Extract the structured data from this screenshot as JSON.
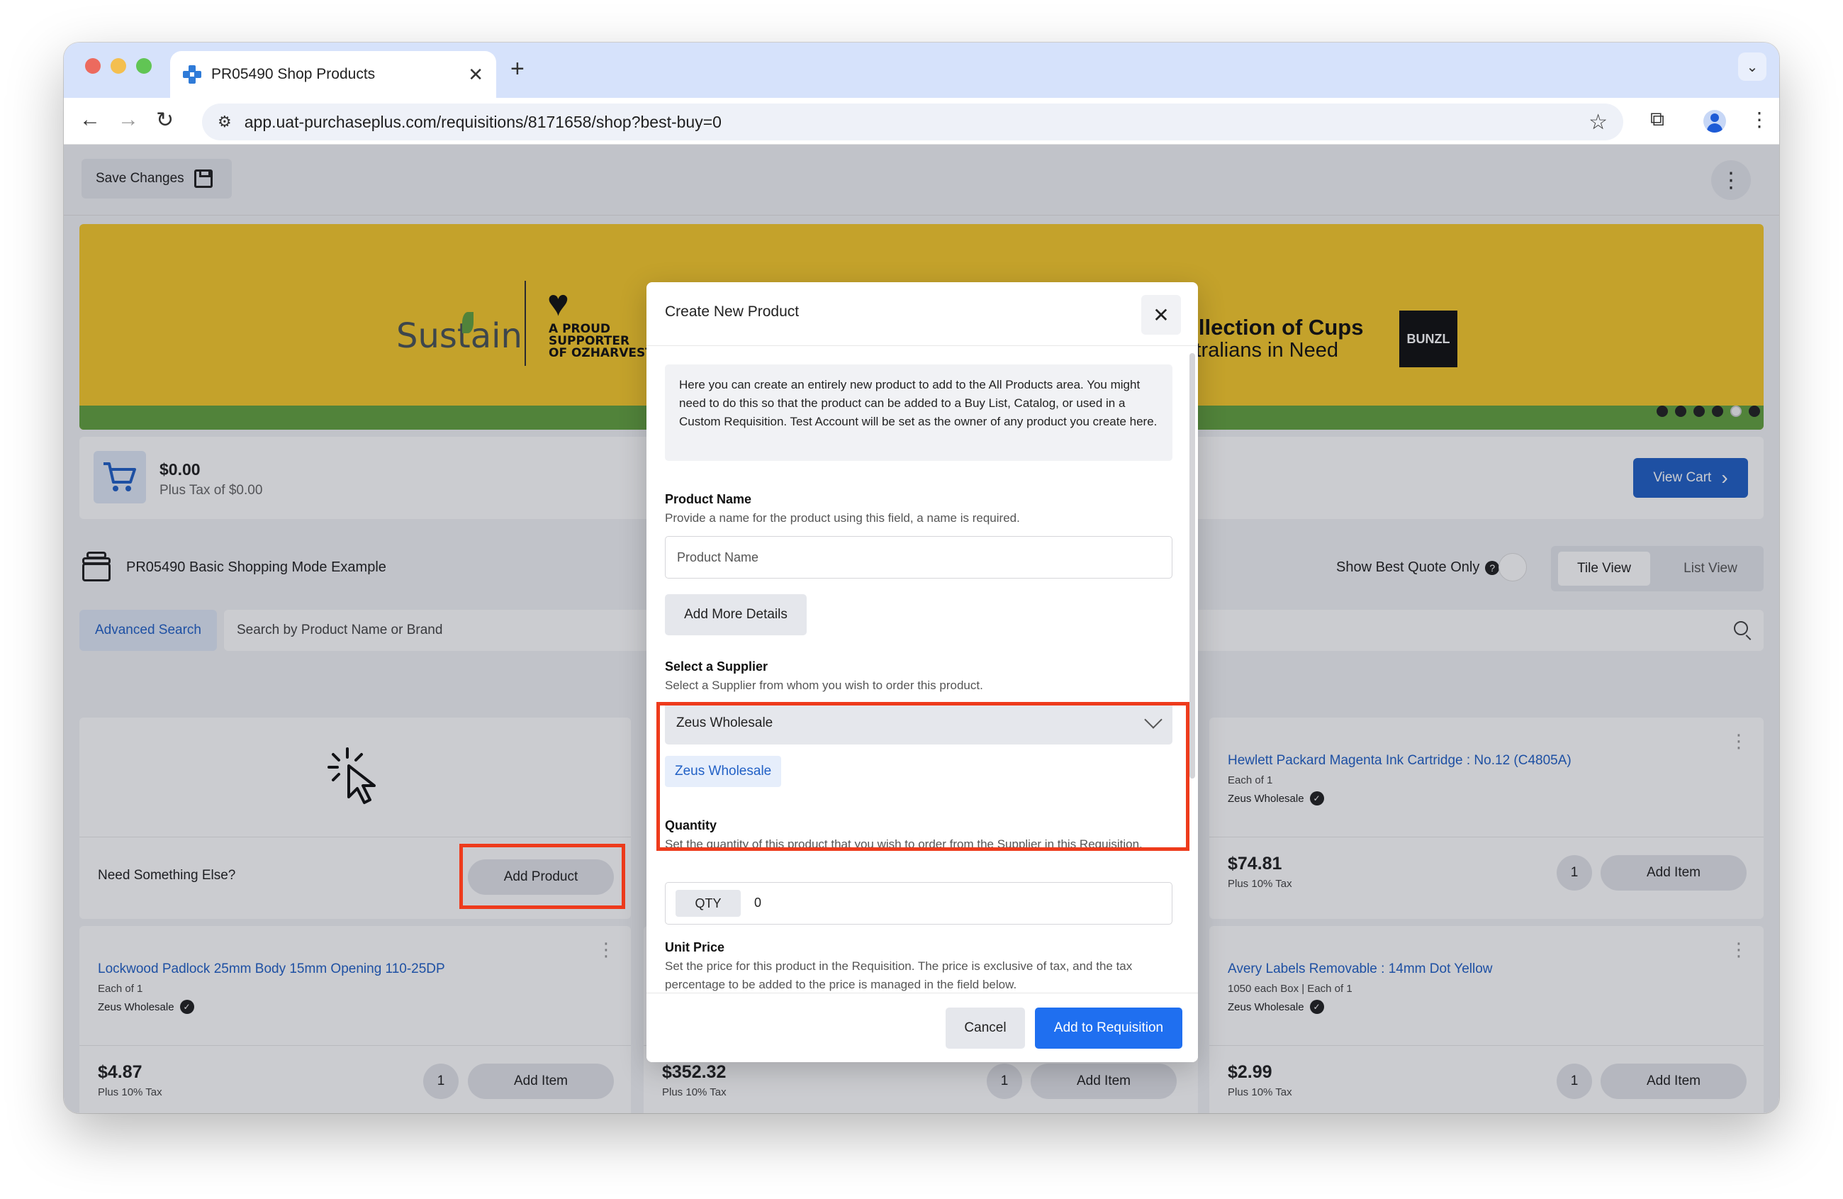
{
  "browser": {
    "tab_title": "PR05490 Shop Products",
    "tab_close": "✕",
    "new_tab": "+",
    "url": "app.uat-purchaseplus.com/requisitions/8171658/shop?best-buy=0",
    "back": "←",
    "forward": "→",
    "reload": "↻",
    "star": "☆",
    "extensions": "⧉",
    "menu": "⋮",
    "tab_menu": "⌄"
  },
  "topbar": {
    "save_label": "Save Changes",
    "more": "⋮"
  },
  "banner": {
    "sustain": "Sustain",
    "heart": "♥",
    "proud_line1": "A PROUD",
    "proud_line2": "SUPPORTER",
    "proud_line3": "OF OZHARVEST",
    "cups_title": "ollection of Cups",
    "cups_sub": "stralians in Need",
    "bunzl": "BUNZL",
    "slide_count": 6,
    "active_slide": 5
  },
  "cart": {
    "total": "$0.00",
    "tax": "Plus Tax of $0.00",
    "view_cart": "View Cart",
    "chevron": "›",
    "cart_icon": "🛒"
  },
  "requisition": {
    "title": "PR05490 Basic Shopping Mode Example",
    "best_quote_label": "Show Best Quote Only",
    "help": "?",
    "tile_view": "Tile View",
    "list_view": "List View"
  },
  "search": {
    "advanced": "Advanced Search",
    "placeholder": "Search by Product Name or Brand"
  },
  "need_card": {
    "label": "Need Something Else?",
    "button": "Add Product"
  },
  "products": [
    {
      "title": "Hewlett Packard Magenta Ink Cartridge : No.12 (C4805A)",
      "unit": "Each of 1",
      "supplier": "Zeus Wholesale",
      "price": "$74.81",
      "tax": "Plus 10% Tax",
      "qty": "1",
      "add": "Add Item"
    },
    {
      "title": "Lockwood Padlock 25mm Body 15mm Opening 110-25DP",
      "unit": "Each of 1",
      "supplier": "Zeus Wholesale",
      "price": "$4.87",
      "tax": "Plus 10% Tax",
      "qty": "1",
      "add": "Add Item"
    },
    {
      "title": "",
      "unit": "",
      "supplier": "",
      "price": "$352.32",
      "tax": "Plus 10% Tax",
      "qty": "1",
      "add": "Add Item"
    },
    {
      "title": "Avery Labels Removable : 14mm Dot Yellow",
      "unit": "1050 each Box | Each of 1",
      "supplier": "Zeus Wholesale",
      "price": "$2.99",
      "tax": "Plus 10% Tax",
      "qty": "1",
      "add": "Add Item"
    }
  ],
  "modal": {
    "title": "Create New Product",
    "close": "✕",
    "info": "Here you can create an entirely new product to add to the All Products area. You might need to do this so that the product can be added to a Buy List, Catalog, or used in a Custom Requisition. Test Account will be set as the owner of any product you create here.",
    "product_name_label": "Product Name",
    "product_name_help": "Provide a name for the product using this field, a name is required.",
    "product_name_placeholder": "Product Name",
    "add_more_details": "Add More Details",
    "supplier_label": "Select a Supplier",
    "supplier_help": "Select a Supplier from whom you wish to order this product.",
    "supplier_selected": "Zeus Wholesale",
    "supplier_chip": "Zeus Wholesale",
    "quantity_label": "Quantity",
    "quantity_help": "Set the quantity of this product that you wish to order from the Supplier in this Requisition.",
    "qty_tag": "QTY",
    "qty_value": "0",
    "unit_price_label": "Unit Price",
    "unit_price_help": "Set the price for this product in the Requisition. The price is exclusive of tax, and the tax percentage to be added to the price is managed in the field below.",
    "cancel": "Cancel",
    "add_to_requisition": "Add to Requisition"
  },
  "colors": {
    "highlight": "#ee3b1c",
    "primary": "#2261c6",
    "banner_yellow": "#f7ca2c",
    "banner_green": "#63a23f"
  }
}
